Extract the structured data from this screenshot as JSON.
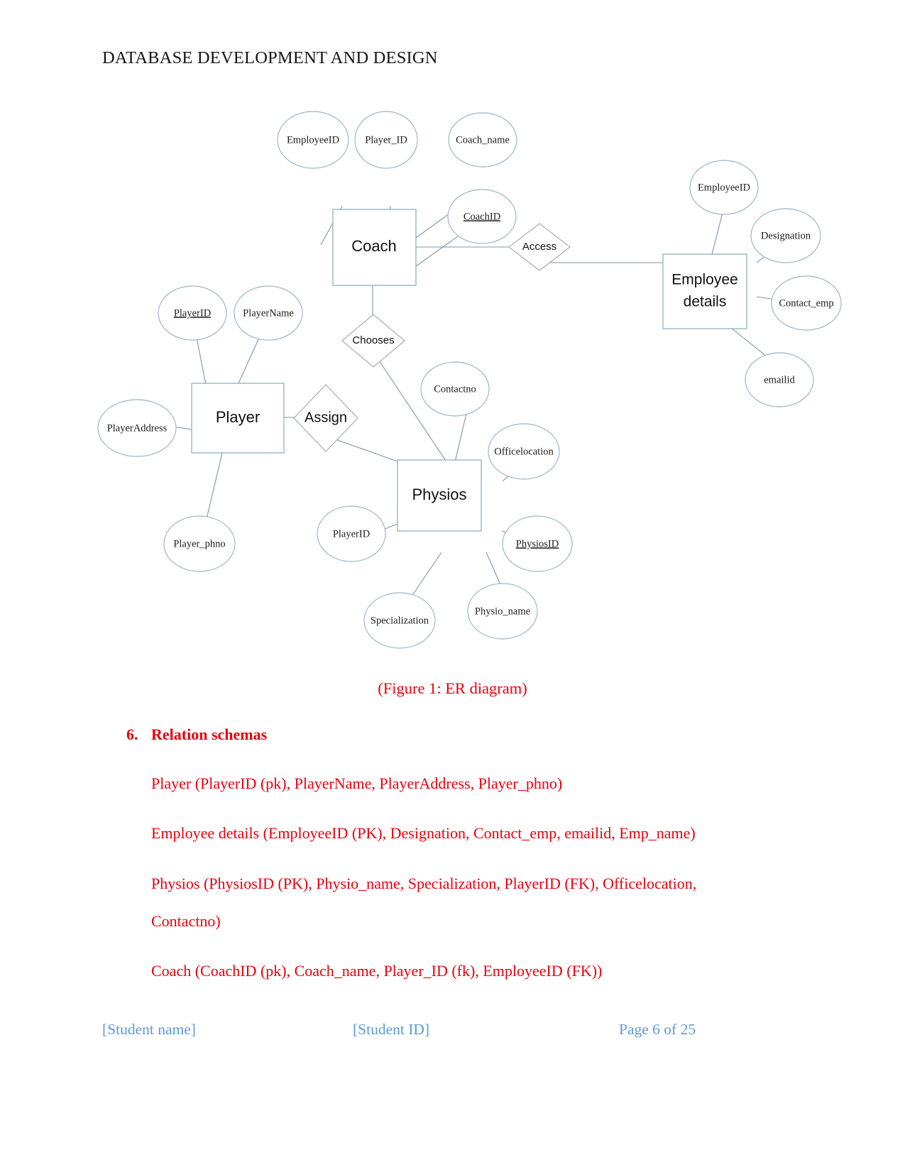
{
  "header": {
    "title": "DATABASE DEVELOPMENT AND DESIGN"
  },
  "figure": {
    "caption": "(Figure 1: ER diagram)"
  },
  "section": {
    "number": "6.",
    "heading": "Relation schemas",
    "lines": [
      "Player (PlayerID (pk), PlayerName, PlayerAddress, Player_phno)",
      "Employee details (EmployeeID (PK), Designation, Contact_emp, emailid, Emp_name)",
      "Physios  (PhysiosID  (PK),  Physio_name,  Specialization,  PlayerID  (FK),  Officelocation,",
      "Contactno)",
      "Coach (CoachID (pk), Coach_name, Player_ID (fk), EmployeeID (FK))"
    ]
  },
  "footer": {
    "student_name": "[Student name]",
    "student_id": "[Student ID]",
    "page_number": "Page 6 of 25"
  },
  "colors": {
    "heading_text": "#141414",
    "body_red": "#e8000d",
    "footer_blue": "#5b9bd5",
    "shape_stroke": "#9ab4c4",
    "diamond_stroke": "#a9a9a9",
    "connector": "#7e97a8"
  },
  "er_diagram": {
    "entities": [
      {
        "id": "coach",
        "label": "Coach"
      },
      {
        "id": "employee_details",
        "label": "Employee details",
        "label_line1": "Employee",
        "label_line2": "details"
      },
      {
        "id": "player",
        "label": "Player"
      },
      {
        "id": "physios",
        "label": "Physios"
      }
    ],
    "relationships": [
      {
        "id": "access",
        "label": "Access",
        "between": [
          "coach",
          "employee_details"
        ]
      },
      {
        "id": "chooses",
        "label": "Chooses",
        "between": [
          "coach",
          "physios"
        ]
      },
      {
        "id": "assign",
        "label": "Assign",
        "between": [
          "player",
          "physios"
        ]
      }
    ],
    "attributes": [
      {
        "entity": "coach",
        "label": "EmployeeID",
        "key": false
      },
      {
        "entity": "coach",
        "label": "Player_ID",
        "key": false
      },
      {
        "entity": "coach",
        "label": "Coach_name",
        "key": false
      },
      {
        "entity": "coach",
        "label": "CoachID",
        "key": true
      },
      {
        "entity": "employee_details",
        "label": "EmployeeID",
        "key": false
      },
      {
        "entity": "employee_details",
        "label": "Designation",
        "key": false
      },
      {
        "entity": "employee_details",
        "label": "Contact_emp",
        "key": false
      },
      {
        "entity": "employee_details",
        "label": "emailid",
        "key": false
      },
      {
        "entity": "player",
        "label": "PlayerID",
        "key": true
      },
      {
        "entity": "player",
        "label": "PlayerName",
        "key": false
      },
      {
        "entity": "player",
        "label": "PlayerAddress",
        "key": false
      },
      {
        "entity": "player",
        "label": "Player_phno",
        "key": false
      },
      {
        "entity": "physios",
        "label": "Contactno",
        "key": false
      },
      {
        "entity": "physios",
        "label": "Officelocation",
        "key": false
      },
      {
        "entity": "physios",
        "label": "PhysiosID",
        "key": true
      },
      {
        "entity": "physios",
        "label": "Physio_name",
        "key": false
      },
      {
        "entity": "physios",
        "label": "Specialization",
        "key": false
      },
      {
        "entity": "physios",
        "label": "PlayerID",
        "key": false
      }
    ],
    "labels": {
      "coach": "Coach",
      "employee_line1": "Employee",
      "employee_line2": "details",
      "player": "Player",
      "physios": "Physios",
      "access": "Access",
      "chooses": "Chooses",
      "assign": "Assign",
      "coach_employeeid": "EmployeeID",
      "coach_playerid": "Player_ID",
      "coach_name": "Coach_name",
      "coach_coachid": "CoachID",
      "emp_employeeid": "EmployeeID",
      "emp_designation": "Designation",
      "emp_contact": "Contact_emp",
      "emp_emailid": "emailid",
      "player_playerid": "PlayerID",
      "player_playername": "PlayerName",
      "player_address": "PlayerAddress",
      "player_phno": "Player_phno",
      "physios_contactno": "Contactno",
      "physios_officelocation": "Officelocation",
      "physios_physiosid": "PhysiosID",
      "physios_physioname": "Physio_name",
      "physios_specialization": "Specialization",
      "physios_playerid": "PlayerID"
    }
  }
}
